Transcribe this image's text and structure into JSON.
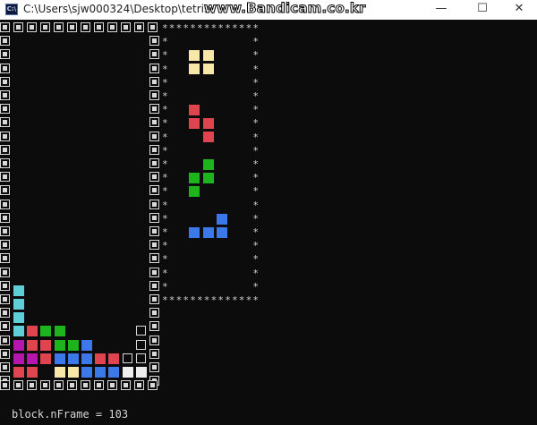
{
  "window": {
    "icon_text": "C:\\",
    "title": "C:\\Users\\sjw000324\\Desktop\\tetris\\",
    "watermark": "www.Bandicam.co.kr",
    "minimize_glyph": "—",
    "maximize_glyph": "☐",
    "close_glyph": "✕"
  },
  "colors": {
    "background": "#0c0c0c",
    "wall": "#d8d8d8",
    "cyan": "#5ecfd6",
    "red": "#e0454f",
    "green": "#1eb41e",
    "blue": "#3d78ea",
    "yellow": "#f7e7a8",
    "magenta": "#b616ae",
    "white": "#eeeeee"
  },
  "board": {
    "cols": 10,
    "rows": 25,
    "locked": [
      [
        0,
        19,
        "cyan"
      ],
      [
        0,
        20,
        "cyan"
      ],
      [
        0,
        21,
        "cyan"
      ],
      [
        0,
        22,
        "cyan"
      ],
      [
        1,
        22,
        "red"
      ],
      [
        2,
        22,
        "green"
      ],
      [
        3,
        22,
        "green"
      ],
      [
        0,
        23,
        "magenta"
      ],
      [
        1,
        23,
        "red"
      ],
      [
        2,
        23,
        "red"
      ],
      [
        3,
        23,
        "green"
      ],
      [
        4,
        23,
        "green"
      ],
      [
        5,
        23,
        "blue"
      ],
      [
        0,
        24,
        "magenta"
      ],
      [
        1,
        24,
        "magenta"
      ],
      [
        2,
        24,
        "red"
      ],
      [
        3,
        24,
        "blue"
      ],
      [
        4,
        24,
        "blue"
      ],
      [
        5,
        24,
        "blue"
      ],
      [
        6,
        24,
        "red"
      ],
      [
        7,
        24,
        "red"
      ],
      [
        0,
        25,
        "red"
      ],
      [
        1,
        25,
        "red"
      ],
      [
        3,
        25,
        "yellow"
      ],
      [
        4,
        25,
        "yellow"
      ],
      [
        5,
        25,
        "blue"
      ],
      [
        6,
        25,
        "blue"
      ],
      [
        7,
        25,
        "blue"
      ],
      [
        8,
        25,
        "white"
      ],
      [
        9,
        25,
        "white"
      ]
    ],
    "hollow": [
      [
        9,
        22
      ],
      [
        9,
        23
      ],
      [
        8,
        24
      ],
      [
        9,
        24
      ]
    ]
  },
  "next_queue": {
    "border_char": "*",
    "pieces": [
      {
        "name": "o-piece",
        "color": "yellow",
        "cells": [
          [
            2,
            1
          ],
          [
            3,
            1
          ],
          [
            2,
            2
          ],
          [
            3,
            2
          ]
        ]
      },
      {
        "name": "z-piece",
        "color": "red",
        "cells": [
          [
            2,
            5
          ],
          [
            2,
            6
          ],
          [
            3,
            6
          ],
          [
            3,
            7
          ]
        ]
      },
      {
        "name": "s-piece",
        "color": "green",
        "cells": [
          [
            3,
            9
          ],
          [
            2,
            10
          ],
          [
            3,
            10
          ],
          [
            2,
            11
          ]
        ]
      },
      {
        "name": "l-piece",
        "color": "blue",
        "cells": [
          [
            4,
            13
          ],
          [
            2,
            14
          ],
          [
            3,
            14
          ],
          [
            4,
            14
          ]
        ]
      }
    ]
  },
  "status": {
    "text": "block.nFrame = 103"
  }
}
